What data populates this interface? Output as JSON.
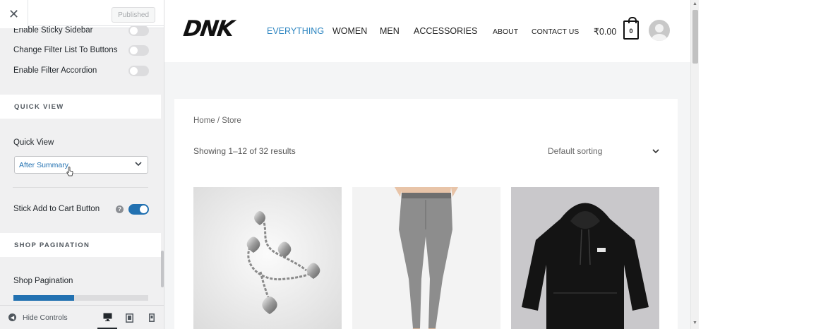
{
  "sidebar": {
    "close_icon": "close-icon",
    "publish_label": "Published",
    "toggles_top": [
      {
        "label": "Enable Sticky Sidebar",
        "on": false
      },
      {
        "label": "Change Filter List To Buttons",
        "on": false
      },
      {
        "label": "Enable Filter Accordion",
        "on": false
      }
    ],
    "quick_view_section": "QUICK VIEW",
    "quick_view_label": "Quick View",
    "quick_view_value": "After Summary",
    "stick_label": "Stick Add to Cart Button",
    "stick_on": true,
    "shop_pagination_section": "SHOP PAGINATION",
    "shop_pagination_label": "Shop Pagination",
    "hide_controls_label": "Hide Controls",
    "devices": [
      "desktop-icon",
      "tablet-icon",
      "mobile-icon"
    ],
    "accent": "#2271b1"
  },
  "site": {
    "logo": "DNK",
    "nav": [
      "EVERYTHING",
      "WOMEN",
      "MEN",
      "ACCESSORIES"
    ],
    "nav_secondary": [
      "ABOUT",
      "CONTACT US"
    ],
    "cart_total": "₹0.00",
    "cart_count": "0",
    "accent": "#2e86c1"
  },
  "shop": {
    "breadcrumb": "Home / Store",
    "results": "Showing 1–12 of 32 results",
    "sorting": "Default sorting",
    "products": [
      {
        "name": "heart-charm-bracelet"
      },
      {
        "name": "grey-skinny-jeans"
      },
      {
        "name": "black-hoodie"
      }
    ]
  }
}
